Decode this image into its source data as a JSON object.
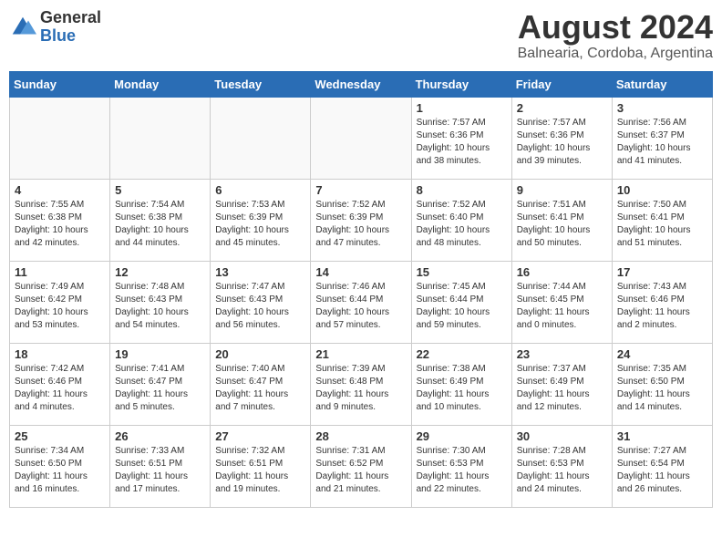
{
  "logo": {
    "general": "General",
    "blue": "Blue"
  },
  "title": "August 2024",
  "subtitle": "Balnearia, Cordoba, Argentina",
  "days_of_week": [
    "Sunday",
    "Monday",
    "Tuesday",
    "Wednesday",
    "Thursday",
    "Friday",
    "Saturday"
  ],
  "weeks": [
    [
      {
        "day": "",
        "info": ""
      },
      {
        "day": "",
        "info": ""
      },
      {
        "day": "",
        "info": ""
      },
      {
        "day": "",
        "info": ""
      },
      {
        "day": "1",
        "info": "Sunrise: 7:57 AM\nSunset: 6:36 PM\nDaylight: 10 hours\nand 38 minutes."
      },
      {
        "day": "2",
        "info": "Sunrise: 7:57 AM\nSunset: 6:36 PM\nDaylight: 10 hours\nand 39 minutes."
      },
      {
        "day": "3",
        "info": "Sunrise: 7:56 AM\nSunset: 6:37 PM\nDaylight: 10 hours\nand 41 minutes."
      }
    ],
    [
      {
        "day": "4",
        "info": "Sunrise: 7:55 AM\nSunset: 6:38 PM\nDaylight: 10 hours\nand 42 minutes."
      },
      {
        "day": "5",
        "info": "Sunrise: 7:54 AM\nSunset: 6:38 PM\nDaylight: 10 hours\nand 44 minutes."
      },
      {
        "day": "6",
        "info": "Sunrise: 7:53 AM\nSunset: 6:39 PM\nDaylight: 10 hours\nand 45 minutes."
      },
      {
        "day": "7",
        "info": "Sunrise: 7:52 AM\nSunset: 6:39 PM\nDaylight: 10 hours\nand 47 minutes."
      },
      {
        "day": "8",
        "info": "Sunrise: 7:52 AM\nSunset: 6:40 PM\nDaylight: 10 hours\nand 48 minutes."
      },
      {
        "day": "9",
        "info": "Sunrise: 7:51 AM\nSunset: 6:41 PM\nDaylight: 10 hours\nand 50 minutes."
      },
      {
        "day": "10",
        "info": "Sunrise: 7:50 AM\nSunset: 6:41 PM\nDaylight: 10 hours\nand 51 minutes."
      }
    ],
    [
      {
        "day": "11",
        "info": "Sunrise: 7:49 AM\nSunset: 6:42 PM\nDaylight: 10 hours\nand 53 minutes."
      },
      {
        "day": "12",
        "info": "Sunrise: 7:48 AM\nSunset: 6:43 PM\nDaylight: 10 hours\nand 54 minutes."
      },
      {
        "day": "13",
        "info": "Sunrise: 7:47 AM\nSunset: 6:43 PM\nDaylight: 10 hours\nand 56 minutes."
      },
      {
        "day": "14",
        "info": "Sunrise: 7:46 AM\nSunset: 6:44 PM\nDaylight: 10 hours\nand 57 minutes."
      },
      {
        "day": "15",
        "info": "Sunrise: 7:45 AM\nSunset: 6:44 PM\nDaylight: 10 hours\nand 59 minutes."
      },
      {
        "day": "16",
        "info": "Sunrise: 7:44 AM\nSunset: 6:45 PM\nDaylight: 11 hours\nand 0 minutes."
      },
      {
        "day": "17",
        "info": "Sunrise: 7:43 AM\nSunset: 6:46 PM\nDaylight: 11 hours\nand 2 minutes."
      }
    ],
    [
      {
        "day": "18",
        "info": "Sunrise: 7:42 AM\nSunset: 6:46 PM\nDaylight: 11 hours\nand 4 minutes."
      },
      {
        "day": "19",
        "info": "Sunrise: 7:41 AM\nSunset: 6:47 PM\nDaylight: 11 hours\nand 5 minutes."
      },
      {
        "day": "20",
        "info": "Sunrise: 7:40 AM\nSunset: 6:47 PM\nDaylight: 11 hours\nand 7 minutes."
      },
      {
        "day": "21",
        "info": "Sunrise: 7:39 AM\nSunset: 6:48 PM\nDaylight: 11 hours\nand 9 minutes."
      },
      {
        "day": "22",
        "info": "Sunrise: 7:38 AM\nSunset: 6:49 PM\nDaylight: 11 hours\nand 10 minutes."
      },
      {
        "day": "23",
        "info": "Sunrise: 7:37 AM\nSunset: 6:49 PM\nDaylight: 11 hours\nand 12 minutes."
      },
      {
        "day": "24",
        "info": "Sunrise: 7:35 AM\nSunset: 6:50 PM\nDaylight: 11 hours\nand 14 minutes."
      }
    ],
    [
      {
        "day": "25",
        "info": "Sunrise: 7:34 AM\nSunset: 6:50 PM\nDaylight: 11 hours\nand 16 minutes."
      },
      {
        "day": "26",
        "info": "Sunrise: 7:33 AM\nSunset: 6:51 PM\nDaylight: 11 hours\nand 17 minutes."
      },
      {
        "day": "27",
        "info": "Sunrise: 7:32 AM\nSunset: 6:51 PM\nDaylight: 11 hours\nand 19 minutes."
      },
      {
        "day": "28",
        "info": "Sunrise: 7:31 AM\nSunset: 6:52 PM\nDaylight: 11 hours\nand 21 minutes."
      },
      {
        "day": "29",
        "info": "Sunrise: 7:30 AM\nSunset: 6:53 PM\nDaylight: 11 hours\nand 22 minutes."
      },
      {
        "day": "30",
        "info": "Sunrise: 7:28 AM\nSunset: 6:53 PM\nDaylight: 11 hours\nand 24 minutes."
      },
      {
        "day": "31",
        "info": "Sunrise: 7:27 AM\nSunset: 6:54 PM\nDaylight: 11 hours\nand 26 minutes."
      }
    ]
  ]
}
